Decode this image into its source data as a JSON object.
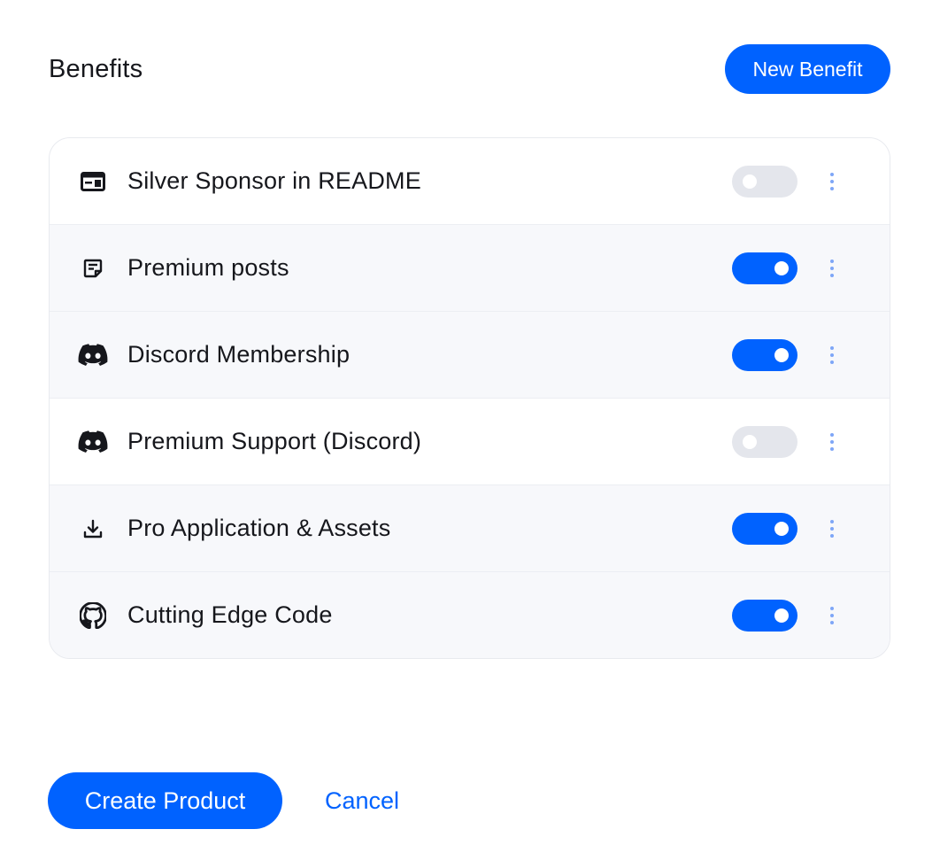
{
  "header": {
    "title": "Benefits",
    "new_benefit_label": "New Benefit"
  },
  "benefits": [
    {
      "label": "Silver Sponsor in README",
      "icon": "ad-banner-icon",
      "enabled": false
    },
    {
      "label": "Premium posts",
      "icon": "article-icon",
      "enabled": true
    },
    {
      "label": "Discord Membership",
      "icon": "discord-icon",
      "enabled": true
    },
    {
      "label": "Premium Support (Discord)",
      "icon": "discord-icon",
      "enabled": false
    },
    {
      "label": "Pro Application & Assets",
      "icon": "download-icon",
      "enabled": true
    },
    {
      "label": "Cutting Edge Code",
      "icon": "github-icon",
      "enabled": true
    }
  ],
  "footer": {
    "create_label": "Create Product",
    "cancel_label": "Cancel"
  },
  "colors": {
    "accent": "#0062ff",
    "toggle_off": "#e4e6ec",
    "kebab": "#7ea6f7",
    "row_on_bg": "#f7f8fb",
    "row_off_bg": "#ffffff"
  }
}
